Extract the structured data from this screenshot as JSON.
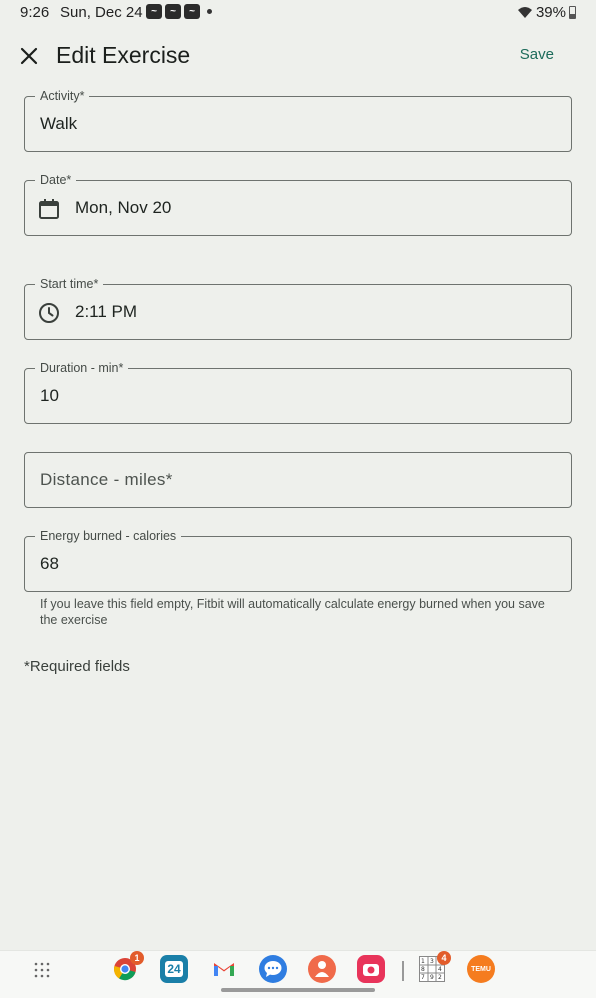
{
  "status_bar": {
    "time": "9:26",
    "date": "Sun, Dec 24",
    "notification_icons": [
      "fitbit-icon",
      "fitbit-icon",
      "fitbit-icon"
    ],
    "battery": "39%"
  },
  "app_bar": {
    "title": "Edit Exercise",
    "save_label": "Save"
  },
  "form": {
    "activity": {
      "label": "Activity*",
      "value": "Walk"
    },
    "date": {
      "label": "Date*",
      "value": "Mon, Nov 20"
    },
    "start_time": {
      "label": "Start time*",
      "value": "2:11 PM"
    },
    "duration": {
      "label": "Duration - min*",
      "value": "10"
    },
    "distance": {
      "placeholder": "Distance - miles*",
      "value": ""
    },
    "energy": {
      "label": "Energy burned - calories",
      "value": "68",
      "helper": "If you leave this field empty, Fitbit will automatically calculate energy burned when you save the exercise"
    },
    "required_note": "*Required fields"
  },
  "taskbar": {
    "apps": [
      {
        "name": "chrome",
        "badge": "1",
        "color": "#ffffff"
      },
      {
        "name": "calendar",
        "badge": "",
        "color": "#1a7fa8",
        "text": "24"
      },
      {
        "name": "gmail",
        "badge": "",
        "color": "#ffffff"
      },
      {
        "name": "messages",
        "badge": "",
        "color": "#2f7de1"
      },
      {
        "name": "contacts",
        "badge": "",
        "color": "#f06a4a"
      },
      {
        "name": "camera",
        "badge": "",
        "color": "#e8345a"
      },
      {
        "name": "sudoku",
        "badge": "4",
        "color": "#ffffff"
      },
      {
        "name": "temu",
        "badge": "",
        "color": "#f57c1f",
        "text": "TEMU"
      }
    ]
  }
}
